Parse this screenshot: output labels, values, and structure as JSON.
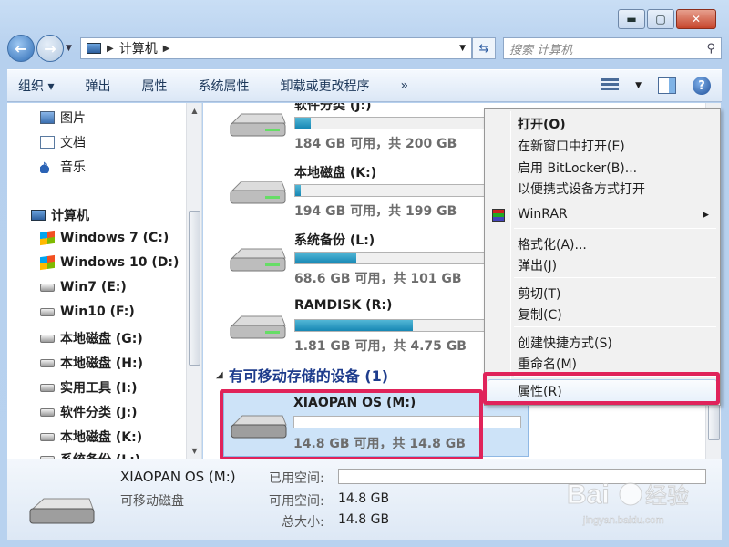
{
  "window": {
    "minimize_icon": "minimize-icon",
    "maximize_icon": "maximize-icon",
    "close_icon": "close-icon"
  },
  "address": {
    "crumb": "计算机",
    "search_placeholder": "搜索 计算机"
  },
  "toolbar": {
    "organize": "组织 ▾",
    "eject": "弹出",
    "properties": "属性",
    "system_properties": "系统属性",
    "uninstall": "卸载或更改程序",
    "more": "»"
  },
  "sidebar": {
    "items": [
      {
        "label": "图片",
        "icon": "pictures-icon"
      },
      {
        "label": "文档",
        "icon": "documents-icon"
      },
      {
        "label": "音乐",
        "icon": "music-icon"
      },
      {
        "label": "计算机",
        "icon": "computer-icon"
      },
      {
        "label": "Windows 7 (C:)",
        "icon": "windows-drive-icon"
      },
      {
        "label": "Windows 10 (D:)",
        "icon": "windows-drive-icon"
      },
      {
        "label": "Win7 (E:)",
        "icon": "drive-icon"
      },
      {
        "label": "Win10 (F:)",
        "icon": "drive-icon"
      },
      {
        "label": "本地磁盘 (G:)",
        "icon": "drive-icon"
      },
      {
        "label": "本地磁盘 (H:)",
        "icon": "drive-icon"
      },
      {
        "label": "实用工具 (I:)",
        "icon": "drive-icon"
      },
      {
        "label": "软件分类 (J:)",
        "icon": "drive-icon"
      },
      {
        "label": "本地磁盘 (K:)",
        "icon": "drive-icon"
      },
      {
        "label": "系统备份 (L:)",
        "icon": "drive-icon"
      }
    ]
  },
  "drives": [
    {
      "name": "软件分类 (J:)",
      "info": "184 GB 可用，共 200 GB",
      "used_fraction": 0.08
    },
    {
      "name": "本地磁盘 (K:)",
      "info": "194 GB 可用，共 199 GB",
      "used_fraction": 0.03
    },
    {
      "name": "系统备份 (L:)",
      "info": "68.6 GB 可用，共 101 GB",
      "used_fraction": 0.32
    },
    {
      "name": "RAMDISK (R:)",
      "info": "1.81 GB 可用，共 4.75 GB",
      "used_fraction": 0.62
    }
  ],
  "removable_group": "有可移动存储的设备 (1)",
  "removable_drive": {
    "name": "XIAOPAN OS (M:)",
    "info": "14.8 GB 可用，共 14.8 GB",
    "used_fraction": 0.0
  },
  "context_menu": {
    "items": [
      "打开(O)",
      "在新窗口中打开(E)",
      "启用 BitLocker(B)...",
      "以便携式设备方式打开",
      "WinRAR",
      "格式化(A)...",
      "弹出(J)",
      "剪切(T)",
      "复制(C)",
      "创建快捷方式(S)",
      "重命名(M)",
      "属性(R)"
    ]
  },
  "details": {
    "name": "XIAOPAN OS (M:)",
    "type": "可移动磁盘",
    "used_label": "已用空间:",
    "free_label": "可用空间:",
    "free_value": "14.8 GB",
    "total_label": "总大小:",
    "total_value": "14.8 GB"
  },
  "watermark": {
    "brand": "Bai",
    "brand_cn": "经验",
    "url": "jingyan.baidu.com"
  }
}
